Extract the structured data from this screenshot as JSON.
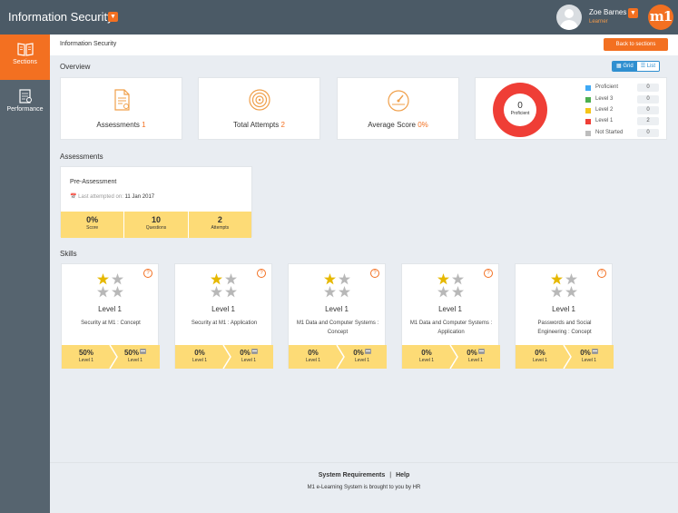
{
  "header": {
    "app_title": "Information Security",
    "user_name": "Zoe Barnes",
    "user_role": "Learner",
    "logo_text": "m1"
  },
  "sidebar": {
    "items": [
      {
        "label": "Sections",
        "icon": "book-icon",
        "active": true
      },
      {
        "label": "Performance",
        "icon": "report-icon",
        "active": false
      }
    ]
  },
  "breadcrumb": "Information Security",
  "back_label": "Back to sections",
  "overview": {
    "title": "Overview",
    "view_grid": "Grid",
    "view_list": "List",
    "stats": [
      {
        "label": "Assessments",
        "value": "1",
        "icon": "document-icon"
      },
      {
        "label": "Total Attempts",
        "value": "2",
        "icon": "target-icon"
      },
      {
        "label": "Average Score",
        "value": "0%",
        "icon": "gauge-icon"
      }
    ],
    "donut": {
      "value": "0",
      "label": "Proficient"
    },
    "legend": [
      {
        "name": "Proficient",
        "count": "0",
        "color": "#3fa9f5"
      },
      {
        "name": "Level 3",
        "count": "0",
        "color": "#4caf50"
      },
      {
        "name": "Level 2",
        "count": "0",
        "color": "#f5c518"
      },
      {
        "name": "Level 1",
        "count": "2",
        "color": "#ef3e36"
      },
      {
        "name": "Not Started",
        "count": "0",
        "color": "#bdbdbd"
      }
    ]
  },
  "assessments": {
    "title": "Assessments",
    "items": [
      {
        "name": "Pre-Assessment",
        "last_label": "Last attempted on:",
        "last_date": "11 Jan 2017",
        "score": "0%",
        "score_label": "Score",
        "questions": "10",
        "questions_label": "Questions",
        "attempts": "2",
        "attempts_label": "Attempts"
      }
    ]
  },
  "skills": {
    "title": "Skills",
    "items": [
      {
        "level": "Level 1",
        "name": "Security at M1 : Concept",
        "left_value": "50%",
        "left_label": "Level 1",
        "right_value": "50%",
        "right_label": "Level 1"
      },
      {
        "level": "Level 1",
        "name": "Security at M1 : Application",
        "left_value": "0%",
        "left_label": "Level 1",
        "right_value": "0%",
        "right_label": "Level 1"
      },
      {
        "level": "Level 1",
        "name": "M1 Data and Computer Systems : Concept",
        "left_value": "0%",
        "left_label": "Level 1",
        "right_value": "0%",
        "right_label": "Level 1"
      },
      {
        "level": "Level 1",
        "name": "M1 Data and Computer Systems : Application",
        "left_value": "0%",
        "left_label": "Level 1",
        "right_value": "0%",
        "right_label": "Level 1"
      },
      {
        "level": "Level 1",
        "name": "Passwords and Social Engineering : Concept",
        "left_value": "0%",
        "left_label": "Level 1",
        "right_value": "0%",
        "right_label": "Level 1"
      }
    ]
  },
  "footer": {
    "link1": "System Requirements",
    "separator": "|",
    "link2": "Help",
    "note": "M1 e-Learning System is brought to you by HR"
  },
  "colors": {
    "accent": "#f37021",
    "topbar": "#4b5a66",
    "sidebar": "#56646f",
    "footer_band": "#fddb76",
    "star_filled": "#e6b800",
    "star_empty": "#b8b8b8"
  }
}
